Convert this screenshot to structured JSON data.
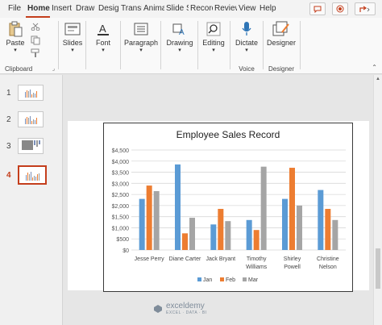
{
  "tabs": [
    "File",
    "Home",
    "Insert",
    "Draw",
    "Design",
    "Transitions",
    "Animations",
    "Slide Show",
    "Record",
    "Review",
    "View",
    "Help"
  ],
  "ribbon": {
    "clipboard": {
      "paste": "Paste",
      "label": "Clipboard"
    },
    "slides": "Slides",
    "font": "Font",
    "paragraph": "Paragraph",
    "drawing": "Drawing",
    "editing": "Editing",
    "voice": {
      "dictate": "Dictate",
      "label": "Voice"
    },
    "designer": {
      "button": "Designer",
      "label": "Designer"
    }
  },
  "slides_pane": [
    {
      "number": "1",
      "selected": false
    },
    {
      "number": "2",
      "selected": false
    },
    {
      "number": "3",
      "selected": false
    },
    {
      "number": "4",
      "selected": true
    }
  ],
  "watermark": {
    "name": "exceldemy",
    "tagline": "EXCEL · DATA · BI"
  },
  "colors": {
    "accent": "#c43e1c",
    "jan": "#5b9bd5",
    "feb": "#ed7d31",
    "mar": "#a5a5a5"
  },
  "chart_data": {
    "type": "bar",
    "title": "Employee Sales Record",
    "categories": [
      "Jesse Perry",
      "Diane Carter",
      "Jack Bryant",
      "Timothy Williams",
      "Shirley Powell",
      "Christine Nelson"
    ],
    "category_lines": [
      [
        "Jesse Perry"
      ],
      [
        "Diane Carter"
      ],
      [
        "Jack Bryant"
      ],
      [
        "Timothy",
        "Williams"
      ],
      [
        "Shirley",
        "Powell"
      ],
      [
        "Christine",
        "Nelson"
      ]
    ],
    "series": [
      {
        "name": "Jan",
        "color": "#5b9bd5",
        "values": [
          2300,
          3850,
          1150,
          1350,
          2300,
          2700
        ]
      },
      {
        "name": "Feb",
        "color": "#ed7d31",
        "values": [
          2900,
          750,
          1850,
          900,
          3700,
          1850
        ]
      },
      {
        "name": "Mar",
        "color": "#a5a5a5",
        "values": [
          2650,
          1450,
          1300,
          3750,
          2000,
          1350
        ]
      }
    ],
    "yticks": [
      "$0",
      "$500",
      "$1,000",
      "$1,500",
      "$2,000",
      "$2,500",
      "$3,000",
      "$3,500",
      "$4,000",
      "$4,500"
    ],
    "ylim": [
      0,
      4500
    ],
    "grid": true,
    "legend_position": "bottom"
  }
}
